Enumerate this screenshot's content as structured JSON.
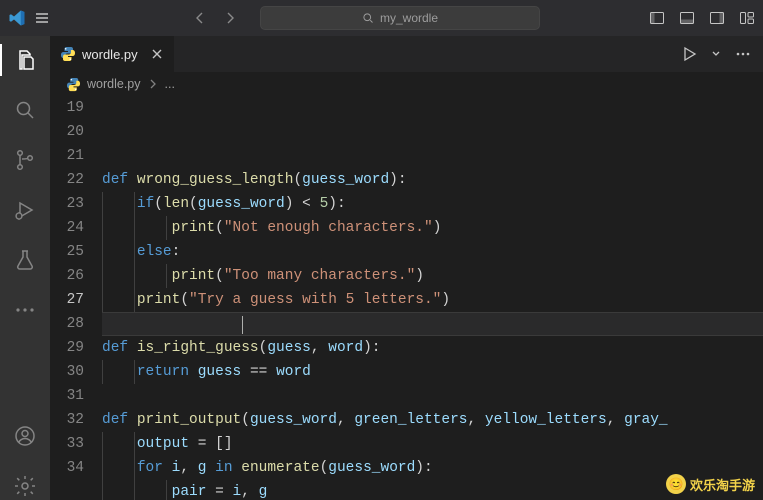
{
  "title_search": "my_wordle",
  "tab": {
    "filename": "wordle.py"
  },
  "breadcrumb": {
    "filename": "wordle.py",
    "rest": "..."
  },
  "activity_items": [
    "explorer",
    "search",
    "source-control",
    "debug",
    "extensions",
    "more"
  ],
  "activity_bottom": [
    "account",
    "settings"
  ],
  "line_numbers": [
    "",
    "19",
    "20",
    "21",
    "22",
    "23",
    "24",
    "25",
    "26",
    "27",
    "28",
    "29",
    "30",
    "31",
    "32",
    "33",
    "34"
  ],
  "current_line_index": 9,
  "code_lines": [
    {
      "raw": "",
      "tokens": []
    },
    {
      "raw": "",
      "tokens": []
    },
    {
      "raw": "",
      "tokens": []
    },
    {
      "raw": "def wrong_guess_length(guess_word):",
      "indent": 0,
      "tokens": [
        [
          "kw",
          "def "
        ],
        [
          "fn",
          "wrong_guess_length"
        ],
        [
          "d",
          "("
        ],
        [
          "var",
          "guess_word"
        ],
        [
          "d",
          "):"
        ]
      ]
    },
    {
      "raw": "    if(len(guess_word) < 5):",
      "indent": 1,
      "tokens": [
        [
          "d",
          "    "
        ],
        [
          "kw",
          "if"
        ],
        [
          "d",
          "("
        ],
        [
          "fn",
          "len"
        ],
        [
          "d",
          "("
        ],
        [
          "var",
          "guess_word"
        ],
        [
          "d",
          ") < "
        ],
        [
          "num",
          "5"
        ],
        [
          "d",
          "):"
        ]
      ]
    },
    {
      "raw": "        print(\"Not enough characters.\")",
      "indent": 2,
      "tokens": [
        [
          "d",
          "        "
        ],
        [
          "fn",
          "print"
        ],
        [
          "d",
          "("
        ],
        [
          "str",
          "\"Not enough characters.\""
        ],
        [
          "d",
          ")"
        ]
      ]
    },
    {
      "raw": "    else:",
      "indent": 1,
      "tokens": [
        [
          "d",
          "    "
        ],
        [
          "kw",
          "else"
        ],
        [
          "d",
          ":"
        ]
      ]
    },
    {
      "raw": "        print(\"Too many characters.\")",
      "indent": 2,
      "tokens": [
        [
          "d",
          "        "
        ],
        [
          "fn",
          "print"
        ],
        [
          "d",
          "("
        ],
        [
          "str",
          "\"Too many characters.\""
        ],
        [
          "d",
          ")"
        ]
      ]
    },
    {
      "raw": "    print(\"Try a guess with 5 letters.\")",
      "indent": 1,
      "tokens": [
        [
          "d",
          "    "
        ],
        [
          "fn",
          "print"
        ],
        [
          "d",
          "("
        ],
        [
          "str",
          "\"Try a guess with 5 letters.\""
        ],
        [
          "d",
          ")"
        ]
      ]
    },
    {
      "raw": "",
      "indent": 0,
      "current": true,
      "tokens": []
    },
    {
      "raw": "def is_right_guess(guess, word):",
      "indent": 0,
      "tokens": [
        [
          "kw",
          "def "
        ],
        [
          "fn",
          "is_right_guess"
        ],
        [
          "d",
          "("
        ],
        [
          "var",
          "guess"
        ],
        [
          "d",
          ", "
        ],
        [
          "var",
          "word"
        ],
        [
          "d",
          "):"
        ]
      ]
    },
    {
      "raw": "    return guess == word",
      "indent": 1,
      "tokens": [
        [
          "d",
          "    "
        ],
        [
          "kw",
          "return"
        ],
        [
          "d",
          " "
        ],
        [
          "var",
          "guess"
        ],
        [
          "d",
          " == "
        ],
        [
          "var",
          "word"
        ]
      ]
    },
    {
      "raw": "",
      "indent": 0,
      "tokens": []
    },
    {
      "raw": "def print_output(guess_word, green_letters, yellow_letters, gray_",
      "indent": 0,
      "tokens": [
        [
          "kw",
          "def "
        ],
        [
          "fn",
          "print_output"
        ],
        [
          "d",
          "("
        ],
        [
          "var",
          "guess_word"
        ],
        [
          "d",
          ", "
        ],
        [
          "var",
          "green_letters"
        ],
        [
          "d",
          ", "
        ],
        [
          "var",
          "yellow_letters"
        ],
        [
          "d",
          ", "
        ],
        [
          "var",
          "gray_"
        ]
      ]
    },
    {
      "raw": "    output = []",
      "indent": 1,
      "tokens": [
        [
          "d",
          "    "
        ],
        [
          "var",
          "output"
        ],
        [
          "d",
          " = []"
        ]
      ]
    },
    {
      "raw": "    for i, g in enumerate(guess_word):",
      "indent": 1,
      "tokens": [
        [
          "d",
          "    "
        ],
        [
          "kw",
          "for"
        ],
        [
          "d",
          " "
        ],
        [
          "var",
          "i"
        ],
        [
          "d",
          ", "
        ],
        [
          "var",
          "g"
        ],
        [
          "d",
          " "
        ],
        [
          "kw",
          "in"
        ],
        [
          "d",
          " "
        ],
        [
          "fn",
          "enumerate"
        ],
        [
          "d",
          "("
        ],
        [
          "var",
          "guess_word"
        ],
        [
          "d",
          "):"
        ]
      ]
    },
    {
      "raw": "        pair = i, g",
      "indent": 2,
      "tokens": [
        [
          "d",
          "        "
        ],
        [
          "var",
          "pair"
        ],
        [
          "d",
          " = "
        ],
        [
          "var",
          "i"
        ],
        [
          "d",
          ", "
        ],
        [
          "var",
          "g"
        ]
      ]
    }
  ],
  "watermark": "欢乐淘手游"
}
